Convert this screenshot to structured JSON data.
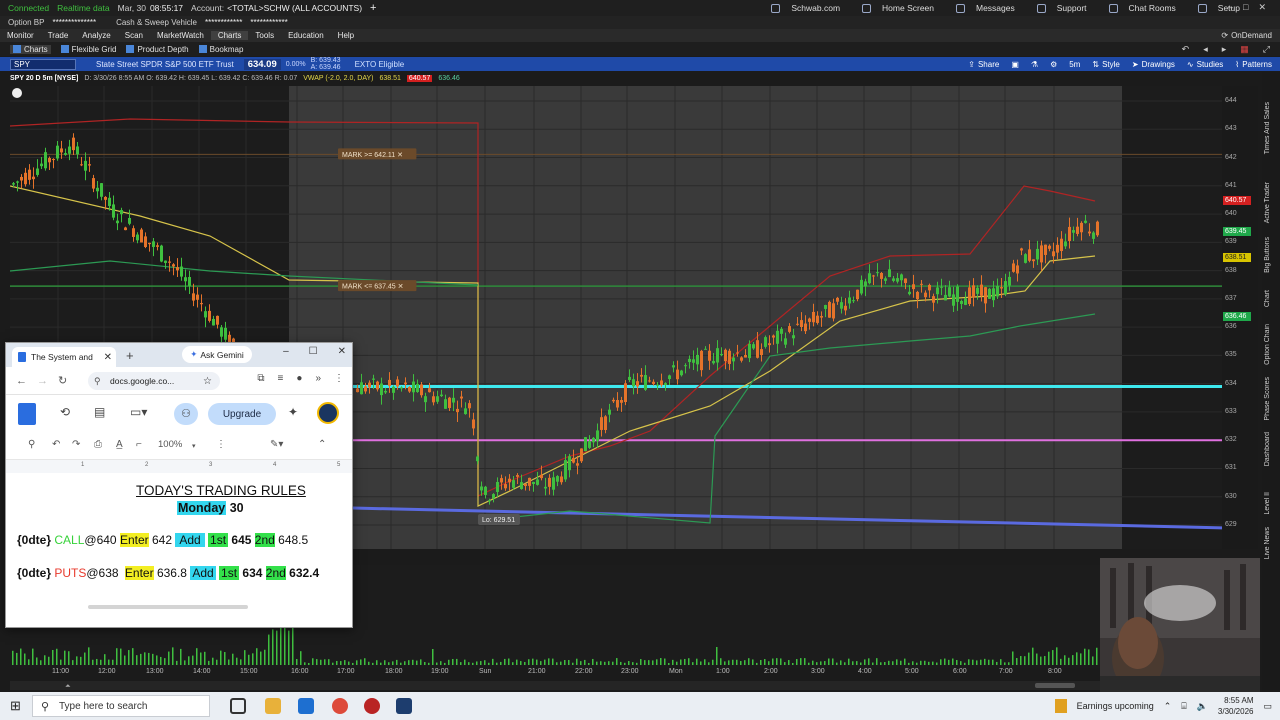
{
  "titlebar": {
    "connected": "Connected",
    "realtime": "Realtime data",
    "date": "Mar, 30",
    "time": "08:55:17",
    "account_label": "Account:",
    "account_value": "<TOTAL>SCHW (ALL ACCOUNTS)",
    "links": [
      "Schwab.com",
      "Home Screen",
      "Messages",
      "Support",
      "Chat Rooms",
      "Setup"
    ]
  },
  "acctrow": {
    "option_bp": "Option BP",
    "masked1": "**************",
    "masked2": "************",
    "sweep": "Cash & Sweep Vehicle",
    "masked3": "************"
  },
  "menu": {
    "items": [
      "Monitor",
      "Trade",
      "Analyze",
      "Scan",
      "MarketWatch",
      "Charts",
      "Tools",
      "Education",
      "Help"
    ],
    "active": "Charts",
    "ondemand": "OnDemand"
  },
  "subbar": {
    "items": [
      "Charts",
      "Flexible Grid",
      "Product Depth",
      "Bookmap"
    ]
  },
  "symbar": {
    "symbol": "SPY",
    "description": "State Street SPDR S&P 500 ETF Trust",
    "last": "634.09",
    "change": "0.00%",
    "bidask_b": "B: 639.43",
    "bidask_a": "A: 639.46",
    "exto": "EXTO Eligible",
    "buttons": [
      "Share",
      "Style",
      "Drawings",
      "Studies",
      "Patterns"
    ],
    "timeframe": "5m"
  },
  "study": {
    "sym": "SPY 20 D 5m [NYSE]",
    "ohlc": "D: 3/30/26 8:55 AM   O: 639.42   H: 639.45   L: 639.42   C: 639.46   R: 0.07",
    "vwap": "VWAP (-2.0, 2.0, DAY)",
    "v1": "638.51",
    "v2": "640.57",
    "v3": "636.46"
  },
  "price_axis": {
    "ticks": [
      "644",
      "643",
      "642",
      "641",
      "640",
      "639",
      "638",
      "637",
      "636",
      "635",
      "634",
      "633",
      "632",
      "631",
      "630",
      "629"
    ],
    "tags": [
      {
        "text": "640.57",
        "color": "#d42020"
      },
      {
        "text": "639.45",
        "color": "#1fa84a"
      },
      {
        "text": "638.51",
        "color": "#d8c400"
      },
      {
        "text": "636.46",
        "color": "#1fa84a"
      }
    ]
  },
  "annotations": {
    "mark_high": "MARK >= 642.11",
    "mark_low": "MARK <= 637.45",
    "low_label": "Lo: 629.51"
  },
  "time_axis": {
    "ticks": [
      "11:00",
      "12:00",
      "13:00",
      "14:00",
      "15:00",
      "16:00",
      "17:00",
      "18:00",
      "19:00",
      "Sun",
      "21:00",
      "22:00",
      "23:00",
      "Mon",
      "1:00",
      "2:00",
      "3:00",
      "4:00",
      "5:00",
      "6:00",
      "7:00",
      "8:00"
    ]
  },
  "sidebar_tabs": [
    "Times And Sales",
    "Active Trader",
    "Big Buttons",
    "Chart",
    "Option Chain",
    "Phase Scores",
    "Dashboard",
    "Level II",
    "Live News"
  ],
  "gdocs": {
    "tab_title": "The System and",
    "ask_gemini": "Ask Gemini",
    "url": "docs.google.co...",
    "upgrade": "Upgrade",
    "zoom": "100%",
    "title": "TODAY'S TRADING RULES",
    "day": "Monday",
    "day_num": "30",
    "call_rule": {
      "tag": "{0dte}",
      "side": "CALL",
      "strike": "@640",
      "enter_label": "Enter",
      "enter": "642",
      "add_label": "Add",
      "t1_label": "1st",
      "t1": "645",
      "t2_label": "2nd",
      "t2": "648.5"
    },
    "put_rule": {
      "tag": "{0dte}",
      "side": "PUTS",
      "strike": "@638",
      "enter_label": "Enter",
      "enter": "636.8",
      "add_label": "Add",
      "t1_label": "1st",
      "t1": "634",
      "t2_label": "2nd",
      "t2": "632.4"
    }
  },
  "taskbar": {
    "search_placeholder": "Type here to search",
    "weather": "Earnings upcoming",
    "time": "8:55 AM",
    "date": "3/30/2026"
  }
}
